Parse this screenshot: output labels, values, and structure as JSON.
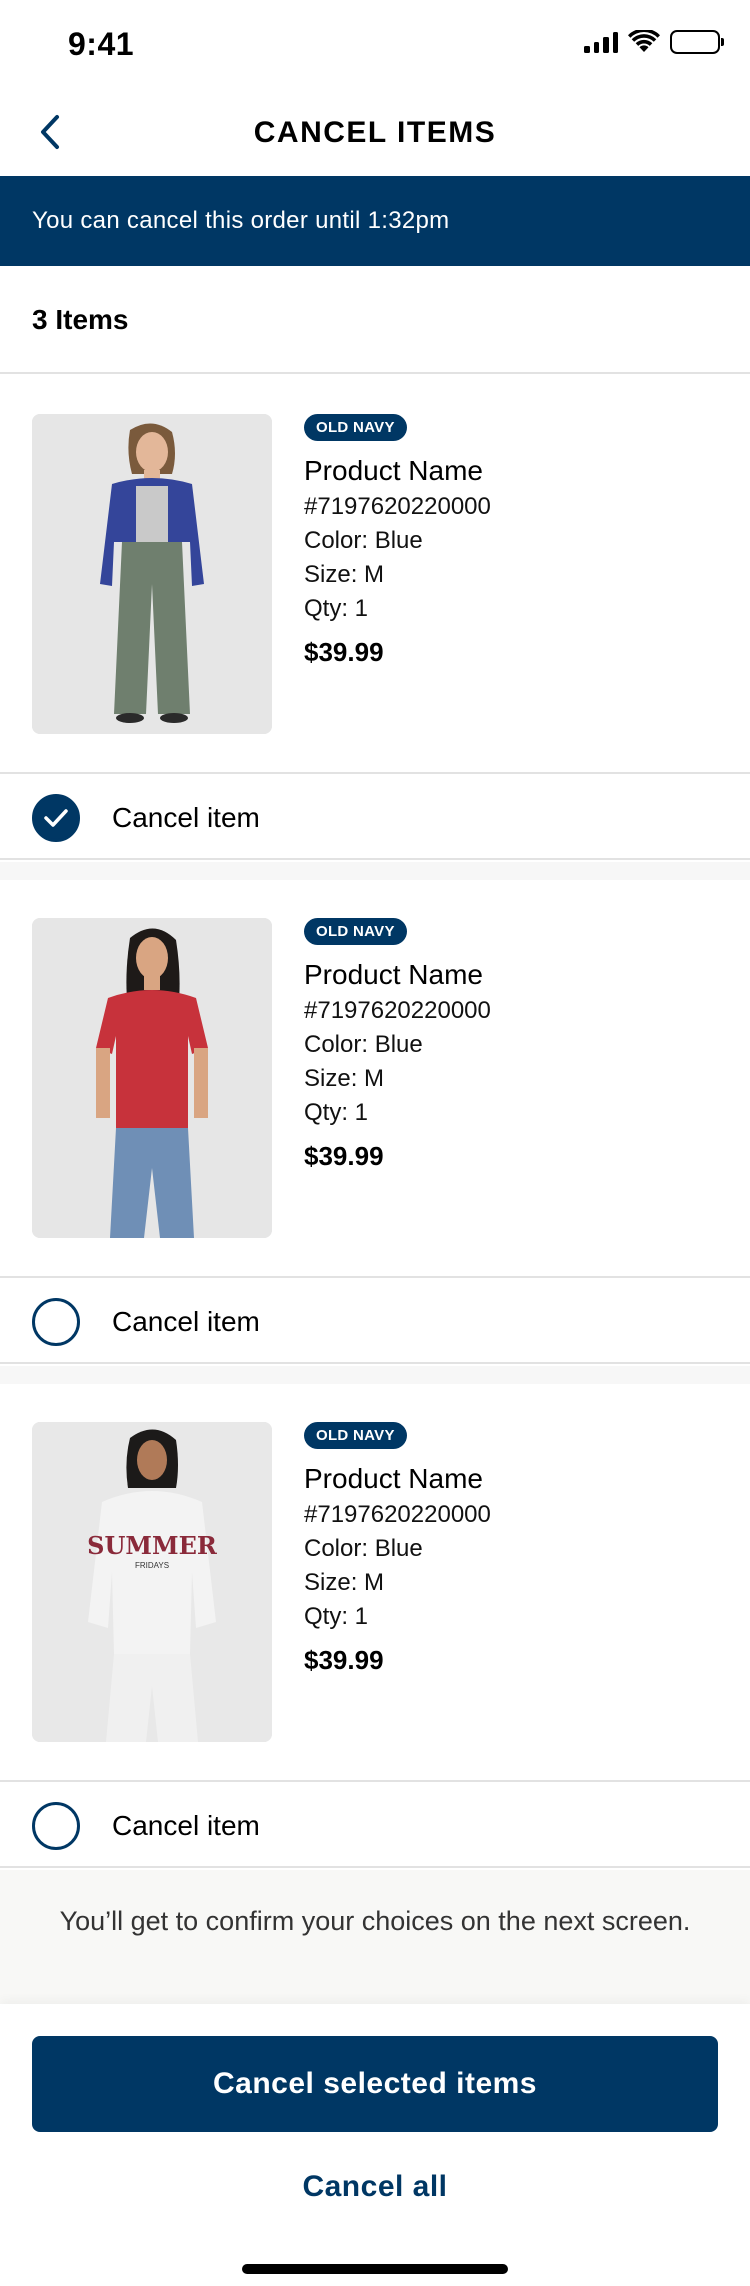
{
  "status_bar": {
    "time": "9:41"
  },
  "header": {
    "title": "CANCEL ITEMS"
  },
  "banner": {
    "text": "You can cancel this order until 1:32pm"
  },
  "items_summary": {
    "count_label": "3 Items"
  },
  "items": [
    {
      "brand": "OLD NAVY",
      "name": "Product Name",
      "sku": "#7197620220000",
      "color": "Color: Blue",
      "size": "Size: M",
      "qty": "Qty: 1",
      "price": "$39.99",
      "cancel_label": "Cancel item",
      "checked": true
    },
    {
      "brand": "OLD NAVY",
      "name": "Product Name",
      "sku": "#7197620220000",
      "color": "Color: Blue",
      "size": "Size: M",
      "qty": "Qty: 1",
      "price": "$39.99",
      "cancel_label": "Cancel item",
      "checked": false
    },
    {
      "brand": "OLD NAVY",
      "name": "Product Name",
      "sku": "#7197620220000",
      "color": "Color: Blue",
      "size": "Size: M",
      "qty": "Qty: 1",
      "price": "$39.99",
      "cancel_label": "Cancel item",
      "checked": false
    }
  ],
  "hoodie_print": {
    "line1": "SUMMER",
    "line2": "FRIDAYS"
  },
  "note": "You’ll get to confirm your choices on the next screen.",
  "footer": {
    "primary_label": "Cancel selected items",
    "secondary_label": "Cancel all"
  },
  "colors": {
    "brand_navy": "#003764",
    "divider": "#e2e2e2"
  }
}
